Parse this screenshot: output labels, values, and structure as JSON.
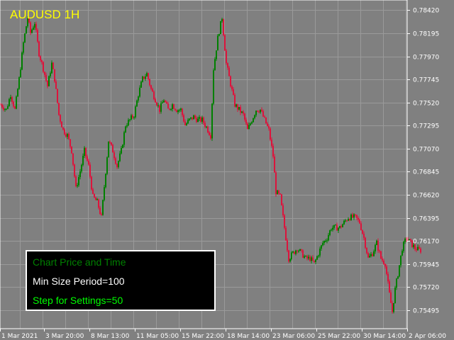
{
  "symbol_title": "AUDUSD 1H",
  "colors": {
    "background": "#808080",
    "bull": "#008000",
    "bear": "#dc143c",
    "title": "#ffff00",
    "panel_bg": "#000000",
    "panel_border": "#ffffff",
    "line1": "#008000",
    "line2": "#ffffff",
    "line3": "#00ff00"
  },
  "info_panel": {
    "line1": "Chart Price and Time",
    "line2": "Min Size Period=100",
    "line3": "Step for Settings=50"
  },
  "chart_data": {
    "type": "candlestick",
    "title": "AUDUSD 1H",
    "grid": true,
    "ylim": [
      0.75315,
      0.7852
    ],
    "y_ticks": [
      "0.78420",
      "0.78195",
      "0.77970",
      "0.77745",
      "0.77520",
      "0.77295",
      "0.77070",
      "0.76845",
      "0.76620",
      "0.76395",
      "0.76170",
      "0.75945",
      "0.75720",
      "0.75495"
    ],
    "x_ticks": [
      "1 Mar 2021",
      "3 Mar 20:00",
      "8 Mar 13:00",
      "11 Mar 05:00",
      "15 Mar 22:00",
      "18 Mar 14:00",
      "23 Mar 06:00",
      "25 Mar 22:00",
      "30 Mar 14:00",
      "2 Apr 06:00"
    ],
    "path": [
      [
        0,
        0.775
      ],
      [
        8,
        0.7745
      ],
      [
        14,
        0.776
      ],
      [
        20,
        0.7745
      ],
      [
        26,
        0.7775
      ],
      [
        32,
        0.781
      ],
      [
        38,
        0.7835
      ],
      [
        42,
        0.782
      ],
      [
        48,
        0.783
      ],
      [
        54,
        0.78
      ],
      [
        60,
        0.7785
      ],
      [
        66,
        0.7768
      ],
      [
        72,
        0.779
      ],
      [
        76,
        0.7775
      ],
      [
        82,
        0.774
      ],
      [
        88,
        0.7725
      ],
      [
        94,
        0.772
      ],
      [
        100,
        0.7705
      ],
      [
        106,
        0.7668
      ],
      [
        112,
        0.7685
      ],
      [
        118,
        0.7705
      ],
      [
        124,
        0.769
      ],
      [
        130,
        0.766
      ],
      [
        136,
        0.7655
      ],
      [
        142,
        0.764
      ],
      [
        148,
        0.7685
      ],
      [
        152,
        0.7715
      ],
      [
        158,
        0.7705
      ],
      [
        164,
        0.769
      ],
      [
        170,
        0.7705
      ],
      [
        176,
        0.773
      ],
      [
        182,
        0.7735
      ],
      [
        188,
        0.774
      ],
      [
        194,
        0.776
      ],
      [
        200,
        0.7775
      ],
      [
        206,
        0.778
      ],
      [
        212,
        0.7765
      ],
      [
        218,
        0.7755
      ],
      [
        224,
        0.7745
      ],
      [
        230,
        0.7755
      ],
      [
        236,
        0.7745
      ],
      [
        242,
        0.775
      ],
      [
        248,
        0.7745
      ],
      [
        254,
        0.7745
      ],
      [
        260,
        0.773
      ],
      [
        266,
        0.7735
      ],
      [
        272,
        0.7738
      ],
      [
        278,
        0.7735
      ],
      [
        284,
        0.7735
      ],
      [
        290,
        0.7728
      ],
      [
        296,
        0.772
      ],
      [
        300,
        0.7785
      ],
      [
        306,
        0.7815
      ],
      [
        312,
        0.7835
      ],
      [
        318,
        0.779
      ],
      [
        324,
        0.777
      ],
      [
        330,
        0.775
      ],
      [
        336,
        0.7745
      ],
      [
        342,
        0.774
      ],
      [
        348,
        0.7725
      ],
      [
        354,
        0.7735
      ],
      [
        360,
        0.7745
      ],
      [
        366,
        0.7745
      ],
      [
        372,
        0.7735
      ],
      [
        378,
        0.7725
      ],
      [
        384,
        0.77
      ],
      [
        388,
        0.7665
      ],
      [
        394,
        0.766
      ],
      [
        400,
        0.763
      ],
      [
        406,
        0.76
      ],
      [
        412,
        0.7605
      ],
      [
        418,
        0.761
      ],
      [
        424,
        0.7605
      ],
      [
        430,
        0.76
      ],
      [
        436,
        0.76
      ],
      [
        442,
        0.7595
      ],
      [
        448,
        0.7605
      ],
      [
        454,
        0.7615
      ],
      [
        460,
        0.762
      ],
      [
        466,
        0.763
      ],
      [
        472,
        0.763
      ],
      [
        478,
        0.763
      ],
      [
        484,
        0.7635
      ],
      [
        490,
        0.764
      ],
      [
        496,
        0.764
      ],
      [
        500,
        0.764
      ],
      [
        506,
        0.7635
      ],
      [
        512,
        0.762
      ],
      [
        518,
        0.76
      ],
      [
        524,
        0.7605
      ],
      [
        530,
        0.7615
      ],
      [
        536,
        0.76
      ],
      [
        542,
        0.7595
      ],
      [
        548,
        0.7565
      ],
      [
        552,
        0.7548
      ],
      [
        556,
        0.757
      ],
      [
        560,
        0.7585
      ],
      [
        566,
        0.761
      ],
      [
        572,
        0.762
      ],
      [
        578,
        0.7615
      ],
      [
        584,
        0.761
      ],
      [
        590,
        0.7608
      ]
    ]
  }
}
